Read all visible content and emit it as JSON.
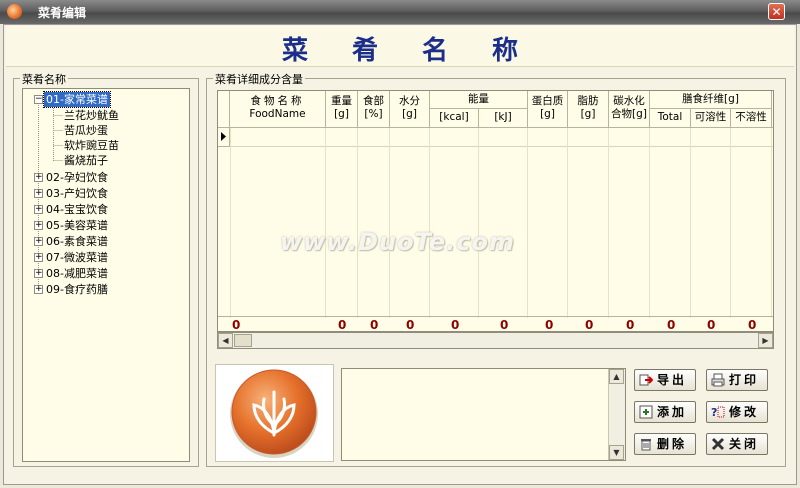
{
  "window": {
    "title": "菜肴编辑",
    "close_glyph": "✕"
  },
  "banner": {
    "title": "菜肴名称"
  },
  "left_panel": {
    "label": "菜肴名称",
    "root_items": [
      {
        "label": "01-家常菜谱",
        "expanded": true,
        "selected": true
      },
      {
        "label": "02-孕妇饮食"
      },
      {
        "label": "03-产妇饮食"
      },
      {
        "label": "04-宝宝饮食"
      },
      {
        "label": "05-美容菜谱"
      },
      {
        "label": "06-素食菜谱"
      },
      {
        "label": "07-微波菜谱"
      },
      {
        "label": "08-减肥菜谱"
      },
      {
        "label": "09-食疗药膳"
      }
    ],
    "children": [
      "兰花炒鱿鱼",
      "苦瓜炒蛋",
      "软炸豌豆苗",
      "酱烧茄子"
    ]
  },
  "detail_panel": {
    "label": "菜肴详细成分含量",
    "columns": {
      "food_name": "食物名称",
      "food_name_en": "FoodName",
      "weight": "重量",
      "weight_unit": "[g]",
      "edible": "食部",
      "edible_unit": "[%]",
      "water": "水分",
      "water_unit": "[g]",
      "energy": "能量",
      "energy_kcal": "[kcal]",
      "energy_kj": "[kJ]",
      "protein": "蛋白质",
      "protein_unit": "[g]",
      "fat": "脂肪",
      "fat_unit": "[g]",
      "carb_1": "碳水化",
      "carb_2": "合物[g]",
      "fiber": "膳食纤维[g]",
      "fiber_total": "Total",
      "fiber_soluble": "可溶性",
      "fiber_insoluble": "不溶性",
      "overflow": "."
    },
    "totals": [
      "0",
      "0",
      "0",
      "0",
      "0",
      "0",
      "0",
      "0",
      "0",
      "0",
      "0",
      "0"
    ]
  },
  "buttons": {
    "export": "导出",
    "print": "打印",
    "add": "添加",
    "edit": "修改",
    "delete": "删除",
    "close": "关闭"
  },
  "watermark": "www.DuoTe.com",
  "colors": {
    "banner_title": "#1b2e8a",
    "totals": "#8b0000",
    "tree_selection": "#316ac5",
    "logo_orange": "#e5702a"
  }
}
